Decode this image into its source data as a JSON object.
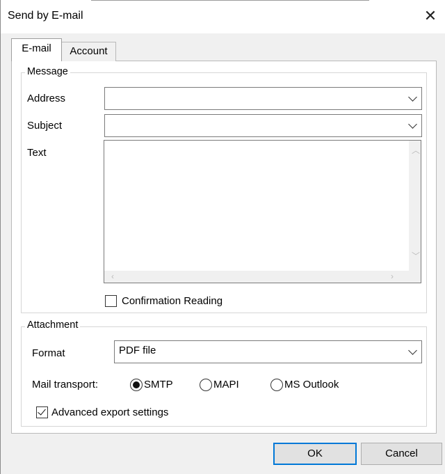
{
  "window": {
    "title": "Send by E-mail",
    "close_glyph": "✕"
  },
  "tabs": [
    {
      "label": "E-mail",
      "active": true
    },
    {
      "label": "Account",
      "active": false
    }
  ],
  "message": {
    "group_title": "Message",
    "address_label": "Address",
    "address_value": "",
    "subject_label": "Subject",
    "subject_value": "",
    "text_label": "Text",
    "text_value": "",
    "confirmation_label": "Confirmation Reading",
    "confirmation_checked": false
  },
  "attachment": {
    "group_title": "Attachment",
    "format_label": "Format",
    "format_value": "PDF file",
    "transport_label": "Mail transport:",
    "transport_options": [
      "SMTP",
      "MAPI",
      "MS Outlook"
    ],
    "transport_selected": "SMTP",
    "advanced_label": "Advanced export settings",
    "advanced_checked": true
  },
  "buttons": {
    "ok": "OK",
    "cancel": "Cancel"
  },
  "colors": {
    "accent": "#0078d7",
    "window_bg": "#f0f0f0",
    "panel_bg": "#ffffff"
  },
  "icons": {
    "close": "close-icon",
    "dropdown": "chevron-down-icon",
    "scroll_up": "scroll-up-arrow-icon",
    "scroll_down": "scroll-down-arrow-icon",
    "scroll_left": "scroll-left-arrow-icon",
    "scroll_right": "scroll-right-arrow-icon"
  }
}
